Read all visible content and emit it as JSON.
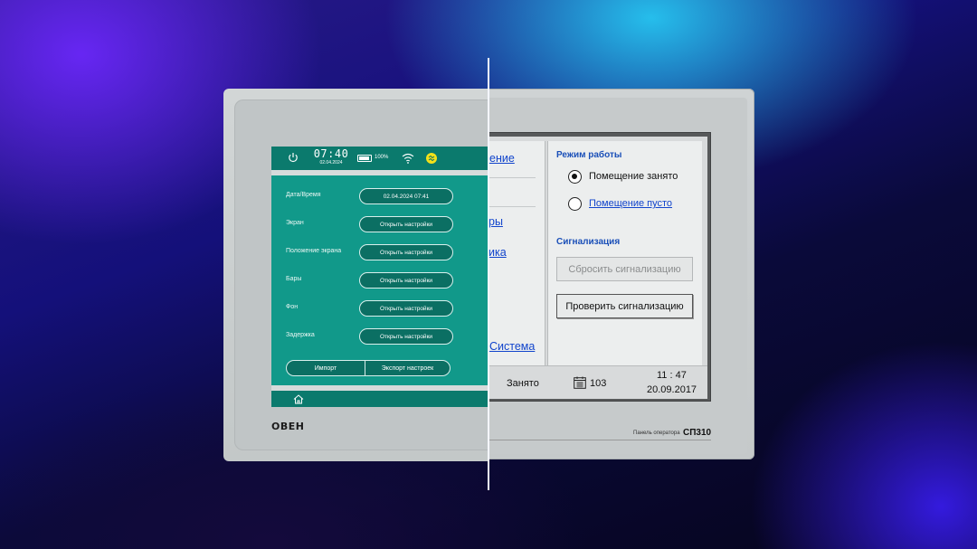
{
  "new_ui": {
    "status": {
      "time": "07:40",
      "date": "02.04.2024",
      "battery": "100%"
    },
    "rows": [
      {
        "label": "Дата/Время",
        "value": "02.04.2024 07:41"
      },
      {
        "label": "Экран",
        "value": "Открыть настройки"
      },
      {
        "label": "Положение экрана",
        "value": "Открыть настройки"
      },
      {
        "label": "Бары",
        "value": "Открыть настройки"
      },
      {
        "label": "Фон",
        "value": "Открыть настройки"
      },
      {
        "label": "Задержка",
        "value": "Открыть настройки"
      }
    ],
    "import_label": "Импорт",
    "export_label": "Экспорт настроек",
    "brand": "ОВЕН"
  },
  "old_ui": {
    "nav": [
      "ение",
      "ры",
      "ика",
      "Система"
    ],
    "mode_title": "Режим работы",
    "mode_options": [
      {
        "label": "Помещение занято",
        "checked": true
      },
      {
        "label": "Помещение пусто",
        "checked": false
      }
    ],
    "alarm_title": "Сигнализация",
    "reset_button": "Сбросить сигнализацию",
    "check_button": "Проверить сигнализацию",
    "status_state": "Занято",
    "status_count": "103",
    "status_time": "11 : 47",
    "status_date": "20.09.2017",
    "panel_caption": "Панель оператора",
    "panel_model": "СП310"
  },
  "colors": {
    "new_screen": "#0d8f80",
    "old_link": "#1144cc",
    "old_title": "#1a4fb8"
  }
}
